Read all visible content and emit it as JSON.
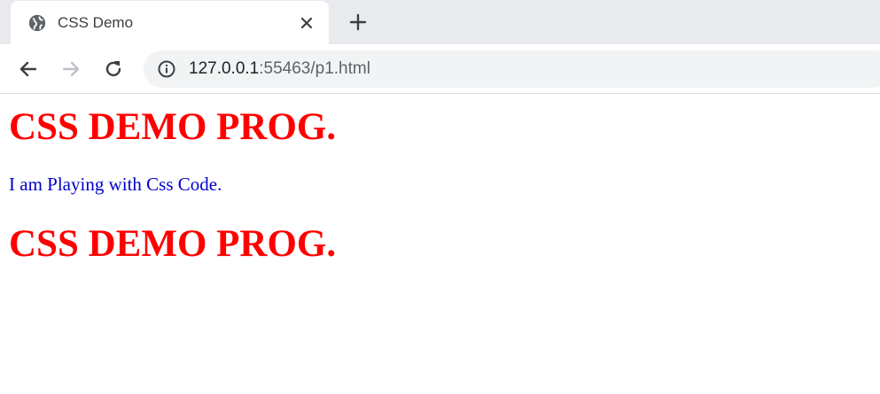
{
  "browser": {
    "tab": {
      "title": "CSS Demo"
    },
    "address_bar": {
      "host": "127.0.0.1",
      "rest": ":55463/p1.html"
    }
  },
  "page": {
    "heading_1": "CSS DEMO PROG.",
    "paragraph": "I am Playing with Css Code.",
    "heading_2": "CSS DEMO PROG."
  },
  "colors": {
    "heading": "#ff0000",
    "paragraph": "#0000cd",
    "tabstrip": "#e8eaed",
    "omnibox": "#f1f3f4"
  }
}
